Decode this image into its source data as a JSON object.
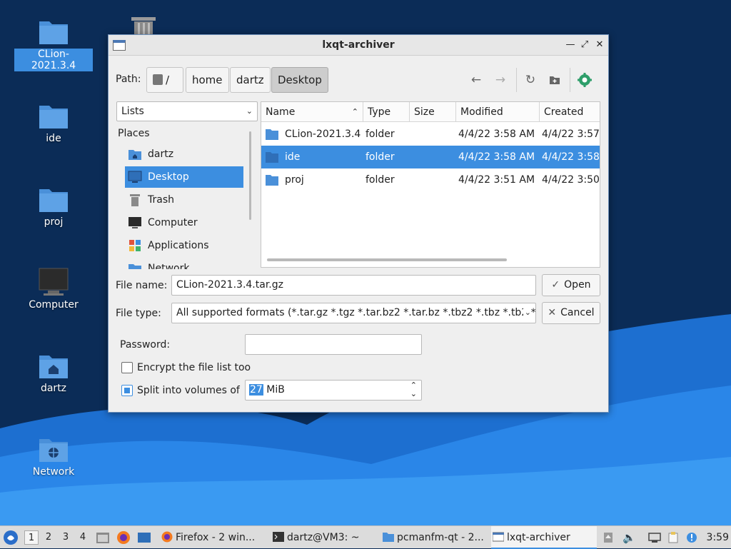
{
  "desktop": {
    "icons": [
      {
        "label": "CLion-2021.3.4",
        "icon": "folder-icon"
      },
      {
        "label": "ide",
        "icon": "folder-icon"
      },
      {
        "label": "proj",
        "icon": "folder-icon"
      },
      {
        "label": "Computer",
        "icon": "computer-icon"
      },
      {
        "label": "dartz",
        "icon": "home-folder-icon"
      },
      {
        "label": "Network",
        "icon": "network-folder-icon"
      }
    ]
  },
  "window": {
    "title": "lxqt-archiver",
    "path_label": "Path:",
    "breadcrumbs": [
      "/",
      "home",
      "dartz",
      "Desktop"
    ],
    "places_combo": "Lists",
    "places_header": "Places",
    "places": [
      "dartz",
      "Desktop",
      "Trash",
      "Computer",
      "Applications",
      "Network"
    ],
    "columns": [
      "Name",
      "Type",
      "Size",
      "Modified",
      "Created"
    ],
    "files": [
      {
        "name": "CLion-2021.3.4",
        "type": "folder",
        "size": "",
        "modified": "4/4/22 3:58 AM",
        "created": "4/4/22 3:57"
      },
      {
        "name": "ide",
        "type": "folder",
        "size": "",
        "modified": "4/4/22 3:58 AM",
        "created": "4/4/22 3:58"
      },
      {
        "name": "proj",
        "type": "folder",
        "size": "",
        "modified": "4/4/22 3:51 AM",
        "created": "4/4/22 3:50"
      }
    ],
    "file_name_label": "File name:",
    "file_name_value": "CLion-2021.3.4.tar.gz",
    "file_type_label": "File type:",
    "file_type_value": "All supported formats (*.tar.gz *.tgz *.tar.bz2 *.tar.bz *.tbz2 *.tbz *.tb2 *.",
    "open_label": "Open",
    "cancel_label": "Cancel",
    "password_label": "Password:",
    "password_value": "",
    "encrypt_label": "Encrypt the file list too",
    "encrypt_checked": false,
    "split_label": "Split into volumes of",
    "split_checked": true,
    "split_number": "27",
    "split_unit": " MiB"
  },
  "taskbar": {
    "desktops": [
      "1",
      "2",
      "3",
      "4"
    ],
    "current_desktop": "1",
    "tasks": [
      {
        "label": "Firefox - 2 win...",
        "icon": "firefox-icon"
      },
      {
        "label": "dartz@VM3: ~",
        "icon": "terminal-icon"
      },
      {
        "label": "pcmanfm-qt - 2...",
        "icon": "folder-icon"
      },
      {
        "label": "lxqt-archiver",
        "icon": "archiver-icon"
      }
    ],
    "clock": "3:59"
  },
  "colors": {
    "accent": "#3c8ee0",
    "folder": "#4a90d9",
    "desktop_bg": "#0b2c57"
  }
}
